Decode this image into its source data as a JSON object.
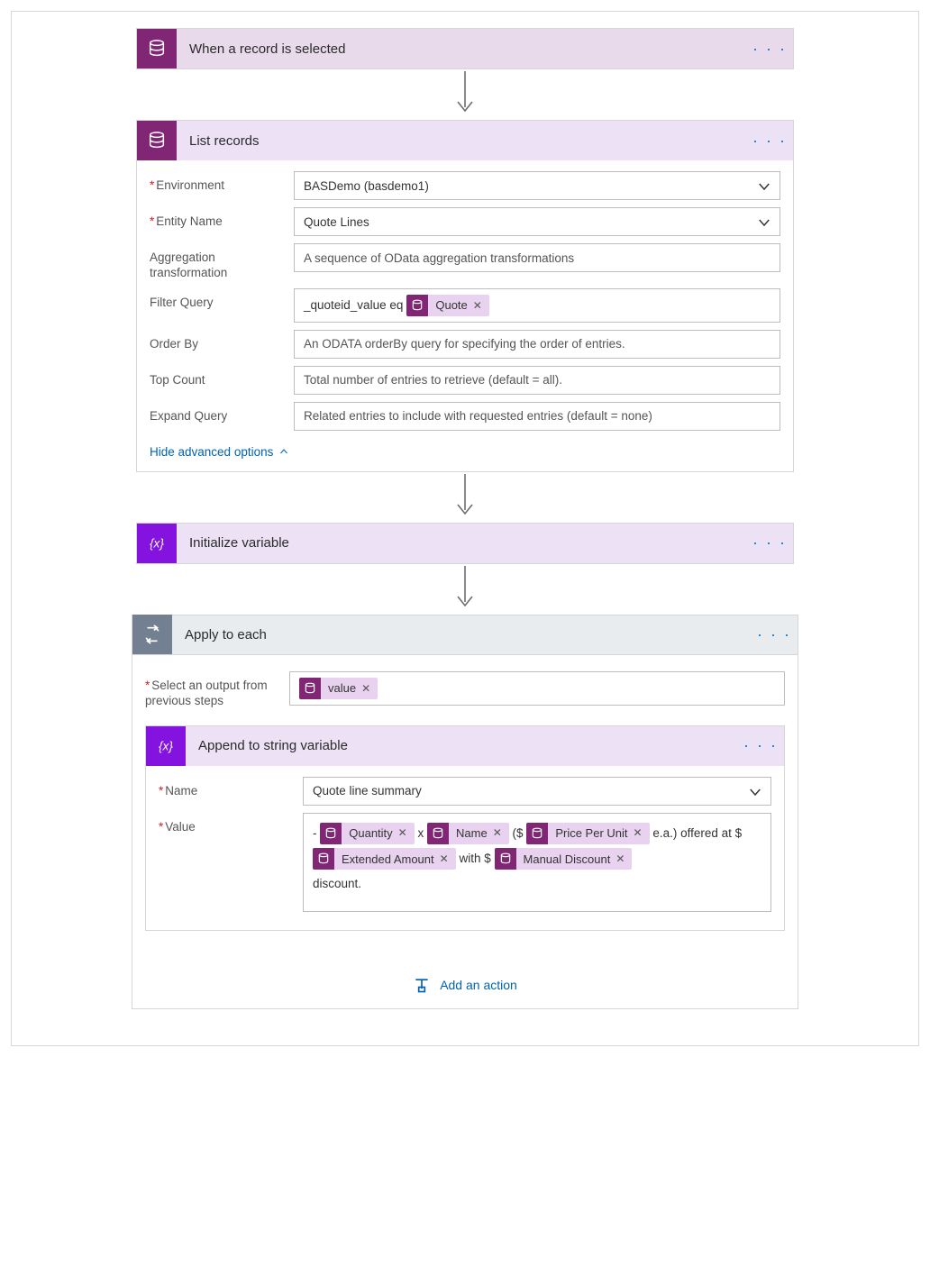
{
  "steps": {
    "trigger": {
      "title": "When a record is selected"
    },
    "list": {
      "title": "List records",
      "fields": {
        "environment_label": "Environment",
        "environment_value": "BASDemo (basdemo1)",
        "entity_label": "Entity Name",
        "entity_value": "Quote Lines",
        "agg_label": "Aggregation transformation",
        "agg_ph": "A sequence of OData aggregation transformations",
        "filter_label": "Filter Query",
        "filter_prefix": "_quoteid_value eq",
        "filter_token": "Quote",
        "order_label": "Order By",
        "order_ph": "An ODATA orderBy query for specifying the order of entries.",
        "top_label": "Top Count",
        "top_ph": "Total number of entries to retrieve (default = all).",
        "expand_label": "Expand Query",
        "expand_ph": "Related entries to include with requested entries (default = none)"
      },
      "hide_link": "Hide advanced options"
    },
    "initvar": {
      "title": "Initialize variable"
    },
    "foreach": {
      "title": "Apply to each",
      "select_label": "Select an output from previous steps",
      "select_token": "value",
      "append": {
        "title": "Append to string variable",
        "name_label": "Name",
        "name_value": "Quote line summary",
        "value_label": "Value",
        "txt": {
          "dash": "- ",
          "x": " x ",
          "open": " ($",
          "ea": " e.a.) ",
          "offered": "offered at $",
          "with": " with $",
          "discount": "discount."
        },
        "tokens": {
          "qty": "Quantity",
          "name": "Name",
          "ppu": "Price Per Unit",
          "ext": "Extended Amount",
          "disc": "Manual Discount"
        }
      }
    },
    "add_action": "Add an action"
  }
}
